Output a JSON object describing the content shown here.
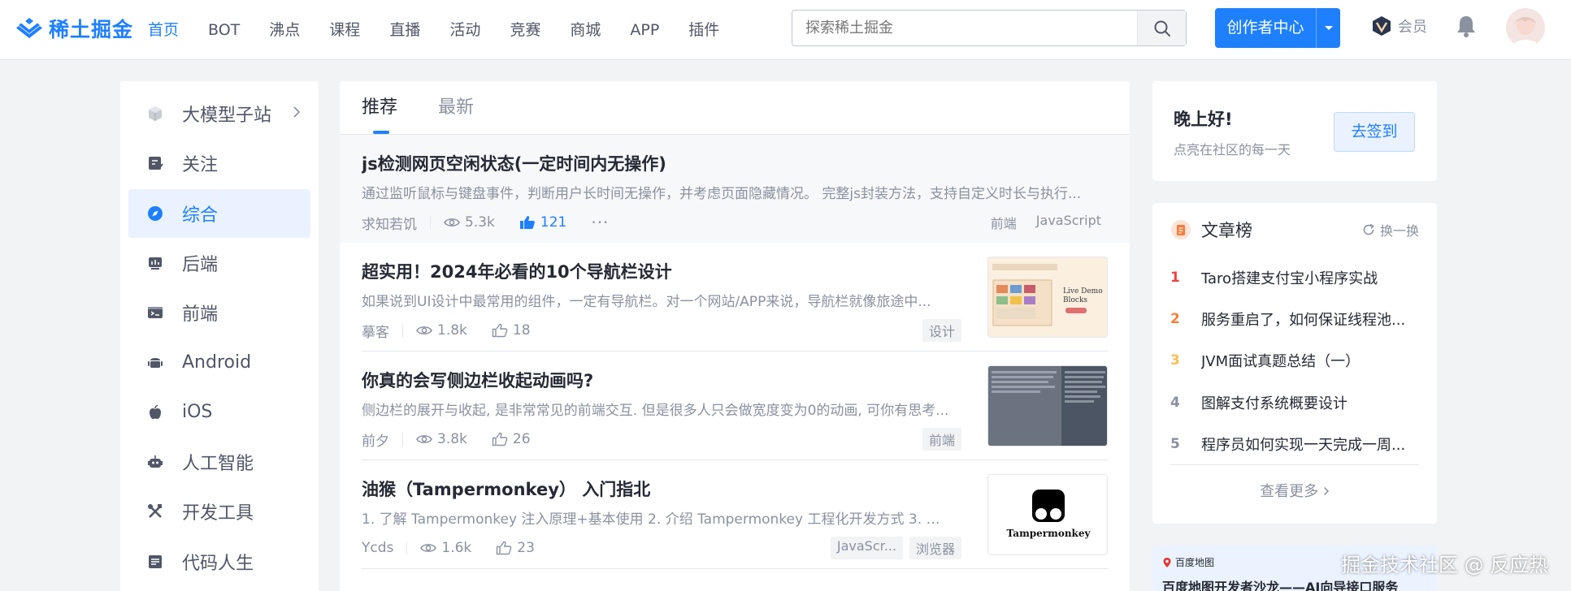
{
  "header": {
    "logo_text": "稀土掘金",
    "nav": [
      "首页",
      "BOT",
      "沸点",
      "课程",
      "直播",
      "活动",
      "竞赛",
      "商城",
      "APP",
      "插件"
    ],
    "search_placeholder": "探索稀土掘金",
    "creator_label": "创作者中心",
    "vip_label": "会员"
  },
  "sidebar": {
    "items": [
      {
        "label": "大模型子站",
        "icon": "cube-icon"
      },
      {
        "label": "关注",
        "icon": "follow-icon"
      },
      {
        "label": "综合",
        "icon": "compass-icon"
      },
      {
        "label": "后端",
        "icon": "backend-icon"
      },
      {
        "label": "前端",
        "icon": "frontend-icon"
      },
      {
        "label": "Android",
        "icon": "android-icon"
      },
      {
        "label": "iOS",
        "icon": "apple-icon"
      },
      {
        "label": "人工智能",
        "icon": "robot-icon"
      },
      {
        "label": "开发工具",
        "icon": "tools-icon"
      },
      {
        "label": "代码人生",
        "icon": "code-life-icon"
      }
    ]
  },
  "feed": {
    "tabs": [
      "推荐",
      "最新"
    ],
    "articles": [
      {
        "title": "js检测网页空闲状态(一定时间内无操作)",
        "desc": "通过监听鼠标与键盘事件，判断用户长时间无操作，并考虑页面隐藏情况。 完整js封装方法，支持自定义时长与执行...",
        "author": "求知若饥",
        "views": "5.3k",
        "likes": "121",
        "tags": [
          "前端",
          "JavaScript"
        ]
      },
      {
        "title": "超实用！2024年必看的10个导航栏设计",
        "desc": "如果说到UI设计中最常用的组件，一定有导航栏。对一个网站/APP来说，导航栏就像旅途中...",
        "author": "摹客",
        "views": "1.8k",
        "likes": "18",
        "tags": [
          "设计"
        ],
        "thumb_text": "Live Demo Blocks"
      },
      {
        "title": "你真的会写侧边栏收起动画吗?",
        "desc": "侧边栏的展开与收起, 是非常常见的前端交互. 但是很多人只会做宽度变为0的动画, 可你有思考...",
        "author": "前夕",
        "views": "3.8k",
        "likes": "26",
        "tags": [
          "前端"
        ]
      },
      {
        "title": "油猴（Tampermonkey） 入门指北",
        "desc": "1. 了解 Tampermonkey 注入原理+基本使用 2. 介绍 Tampermonkey 工程化开发方式 3. 开...",
        "author": "Ycds",
        "views": "1.6k",
        "likes": "23",
        "tags": [
          "JavaScr...",
          "浏览器"
        ],
        "thumb_text": "Tampermonkey"
      }
    ]
  },
  "signin": {
    "greeting": "晚上好!",
    "sub": "点亮在社区的每一天",
    "button": "去签到"
  },
  "ranking": {
    "title": "文章榜",
    "refresh": "换一换",
    "items": [
      {
        "num": "1",
        "text": "Taro搭建支付宝小程序实战"
      },
      {
        "num": "2",
        "text": "服务重启了，如何保证线程池..."
      },
      {
        "num": "3",
        "text": "JVM面试真题总结（一）"
      },
      {
        "num": "4",
        "text": "图解支付系统概要设计"
      },
      {
        "num": "5",
        "text": "程序员如何实现一天完成一周..."
      }
    ],
    "more": "查看更多"
  },
  "ad": {
    "brand": "百度地图",
    "title": "百度地图开发者沙龙——AI向导接口服务"
  },
  "watermark": "掘金技术社区 @ 反应热",
  "colors": {
    "accent": "#1e80ff",
    "bg": "#f2f3f5",
    "rank1": "#f04142",
    "rank2": "#fb7d35",
    "rank3": "#ffbc4f"
  }
}
